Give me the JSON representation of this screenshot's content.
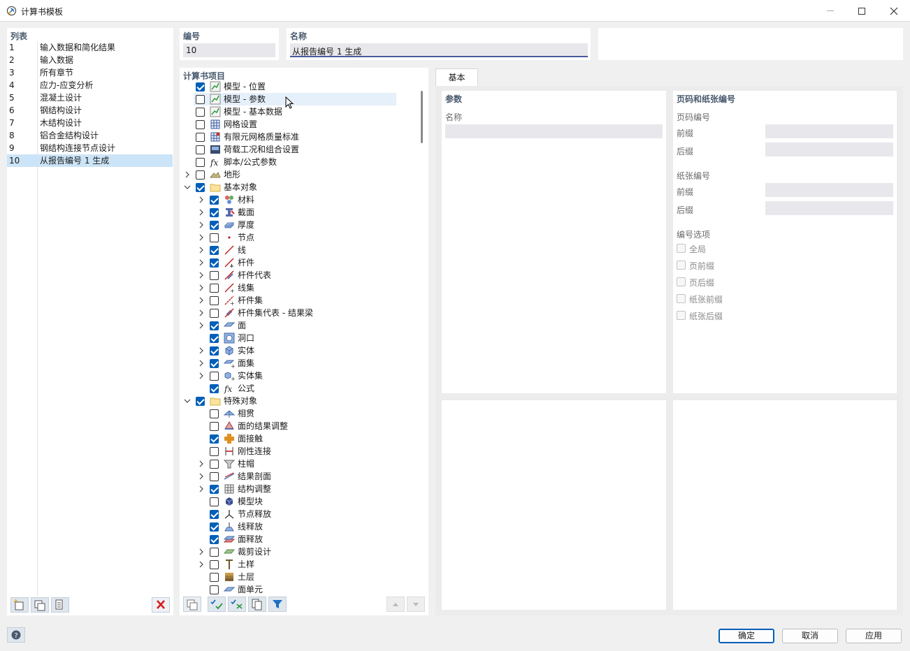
{
  "window": {
    "title": "计算书模板",
    "minimize_icon": "minimize-icon",
    "maximize_icon": "maximize-icon",
    "close_icon": "close-icon"
  },
  "list_panel": {
    "header": "列表",
    "items": [
      {
        "num": "1",
        "label": "输入数据和简化结果"
      },
      {
        "num": "2",
        "label": "输入数据"
      },
      {
        "num": "3",
        "label": "所有章节"
      },
      {
        "num": "4",
        "label": "应力-应变分析"
      },
      {
        "num": "5",
        "label": "混凝土设计"
      },
      {
        "num": "6",
        "label": "钢结构设计"
      },
      {
        "num": "7",
        "label": "木结构设计"
      },
      {
        "num": "8",
        "label": "铝合金结构设计"
      },
      {
        "num": "9",
        "label": "钢结构连接节点设计"
      },
      {
        "num": "10",
        "label": "从报告编号 1 生成"
      }
    ],
    "selected_index": 9
  },
  "number_field": {
    "label": "编号",
    "value": "10"
  },
  "name_field": {
    "label": "名称",
    "value": "从报告编号 1 生成"
  },
  "report_items": {
    "header": "计算书项目",
    "items": [
      {
        "label": "模型 - 位置",
        "checked": true,
        "expand": "none",
        "level": 0,
        "icon": "model-icon"
      },
      {
        "label": "模型 - 参数",
        "checked": false,
        "expand": "none",
        "level": 0,
        "icon": "model-icon"
      },
      {
        "label": "模型 - 基本数据",
        "checked": false,
        "expand": "none",
        "level": 0,
        "icon": "model-icon"
      },
      {
        "label": "网格设置",
        "checked": false,
        "expand": "none",
        "level": 0,
        "icon": "mesh-settings-icon"
      },
      {
        "label": "有限元网格质量标准",
        "checked": false,
        "expand": "none",
        "level": 0,
        "icon": "mesh-quality-icon"
      },
      {
        "label": "荷载工况和组合设置",
        "checked": false,
        "expand": "none",
        "level": 0,
        "icon": "load-cases-icon"
      },
      {
        "label": "脚本/公式参数",
        "checked": false,
        "expand": "none",
        "level": 0,
        "icon": "formula-icon"
      },
      {
        "label": "地形",
        "checked": false,
        "expand": "collapsed",
        "level": 0,
        "icon": "terrain-icon"
      },
      {
        "label": "基本对象",
        "checked": true,
        "expand": "expanded",
        "level": 0,
        "icon": "folder-icon"
      },
      {
        "label": "材料",
        "checked": true,
        "expand": "collapsed",
        "level": 1,
        "icon": "material-icon"
      },
      {
        "label": "截面",
        "checked": true,
        "expand": "collapsed",
        "level": 1,
        "icon": "section-icon"
      },
      {
        "label": "厚度",
        "checked": true,
        "expand": "collapsed",
        "level": 1,
        "icon": "thickness-icon"
      },
      {
        "label": "节点",
        "checked": false,
        "expand": "collapsed",
        "level": 1,
        "icon": "node-icon"
      },
      {
        "label": "线",
        "checked": true,
        "expand": "collapsed",
        "level": 1,
        "icon": "line-icon"
      },
      {
        "label": "杆件",
        "checked": true,
        "expand": "collapsed",
        "level": 1,
        "icon": "member-icon"
      },
      {
        "label": "杆件代表",
        "checked": false,
        "expand": "collapsed",
        "level": 1,
        "icon": "member-representative-icon"
      },
      {
        "label": "线集",
        "checked": false,
        "expand": "collapsed",
        "level": 1,
        "icon": "line-set-icon"
      },
      {
        "label": "杆件集",
        "checked": false,
        "expand": "collapsed",
        "level": 1,
        "icon": "member-set-icon"
      },
      {
        "label": "杆件集代表 - 结果梁",
        "checked": false,
        "expand": "collapsed",
        "level": 1,
        "icon": "result-beam-icon"
      },
      {
        "label": "面",
        "checked": true,
        "expand": "collapsed",
        "level": 1,
        "icon": "surface-icon"
      },
      {
        "label": "洞口",
        "checked": true,
        "expand": "none",
        "level": 1,
        "icon": "opening-icon"
      },
      {
        "label": "实体",
        "checked": true,
        "expand": "collapsed",
        "level": 1,
        "icon": "solid-icon"
      },
      {
        "label": "面集",
        "checked": true,
        "expand": "collapsed",
        "level": 1,
        "icon": "surface-set-icon"
      },
      {
        "label": "实体集",
        "checked": false,
        "expand": "collapsed",
        "level": 1,
        "icon": "solid-set-icon"
      },
      {
        "label": "公式",
        "checked": true,
        "expand": "none",
        "level": 1,
        "icon": "formula-icon"
      },
      {
        "label": "特殊对象",
        "checked": true,
        "expand": "expanded",
        "level": 0,
        "icon": "folder-icon"
      },
      {
        "label": "相贯",
        "checked": false,
        "expand": "none",
        "level": 1,
        "icon": "intersection-icon"
      },
      {
        "label": "面的结果调整",
        "checked": false,
        "expand": "none",
        "level": 1,
        "icon": "surface-result-adjustment-icon"
      },
      {
        "label": "面接触",
        "checked": true,
        "expand": "none",
        "level": 1,
        "icon": "surface-contact-icon"
      },
      {
        "label": "刚性连接",
        "checked": false,
        "expand": "none",
        "level": 1,
        "icon": "rigid-link-icon"
      },
      {
        "label": "柱帽",
        "checked": false,
        "expand": "collapsed",
        "level": 1,
        "icon": "column-cap-icon"
      },
      {
        "label": "结果剖面",
        "checked": false,
        "expand": "collapsed",
        "level": 1,
        "icon": "result-section-icon"
      },
      {
        "label": "结构调整",
        "checked": true,
        "expand": "collapsed",
        "level": 1,
        "icon": "structure-modification-icon"
      },
      {
        "label": "模型块",
        "checked": false,
        "expand": "none",
        "level": 1,
        "icon": "block-icon"
      },
      {
        "label": "节点释放",
        "checked": true,
        "expand": "none",
        "level": 1,
        "icon": "node-release-icon"
      },
      {
        "label": "线释放",
        "checked": true,
        "expand": "none",
        "level": 1,
        "icon": "line-release-icon"
      },
      {
        "label": "面释放",
        "checked": true,
        "expand": "none",
        "level": 1,
        "icon": "surface-release-icon"
      },
      {
        "label": "裁剪设计",
        "checked": false,
        "expand": "collapsed",
        "level": 1,
        "icon": "cutting-pattern-icon"
      },
      {
        "label": "土样",
        "checked": false,
        "expand": "collapsed",
        "level": 1,
        "icon": "borehole-icon"
      },
      {
        "label": "土层",
        "checked": false,
        "expand": "none",
        "level": 1,
        "icon": "soil-layer-icon"
      },
      {
        "label": "面单元",
        "checked": false,
        "expand": "none",
        "level": 1,
        "icon": "surface-element-icon"
      }
    ],
    "hover_index": 1
  },
  "tabs": [
    {
      "label": "基本"
    }
  ],
  "params_panel": {
    "title": "参数",
    "name_label": "名称",
    "name_value": ""
  },
  "page_panel": {
    "title": "页码和纸张编号",
    "page_numbering_label": "页码编号",
    "page_prefix_label": "前缀",
    "page_suffix_label": "后缀",
    "sheet_numbering_label": "纸张编号",
    "sheet_prefix_label": "前缀",
    "sheet_suffix_label": "后缀",
    "options_label": "编号选项",
    "options": [
      {
        "label": "全局",
        "checked": false
      },
      {
        "label": "页前缀",
        "checked": false
      },
      {
        "label": "页后缀",
        "checked": false
      },
      {
        "label": "纸张前缀",
        "checked": false
      },
      {
        "label": "纸张后缀",
        "checked": false
      }
    ]
  },
  "buttons": {
    "ok": "确定",
    "cancel": "取消",
    "apply": "应用"
  },
  "colors": {
    "accent": "#005fb8",
    "selected_row": "#cce4f7",
    "header_text": "#4a5a6e",
    "delete_red": "#d81e1e"
  }
}
